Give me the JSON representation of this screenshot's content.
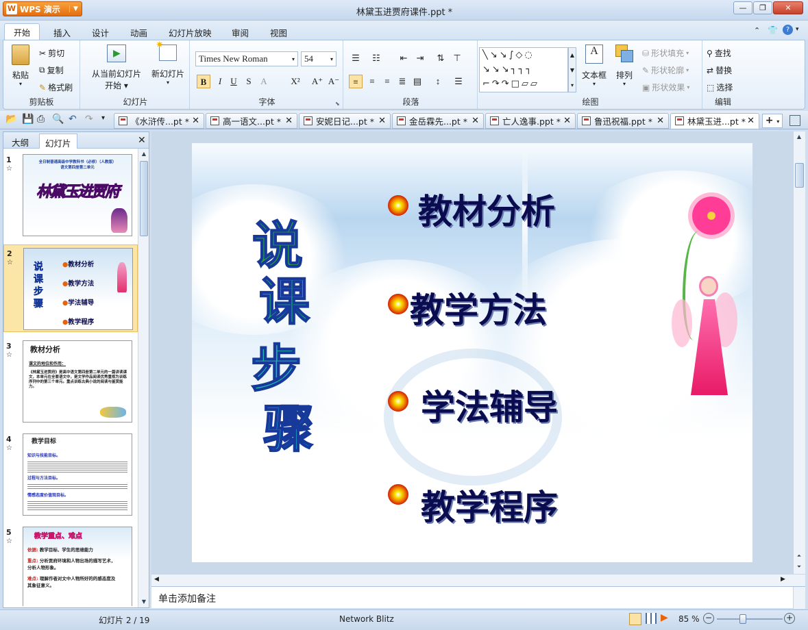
{
  "titlebar": {
    "app_button": "WPS 演示",
    "window_title": "林黛玉进贾府课件.ppt *"
  },
  "menu": [
    "开始",
    "插入",
    "设计",
    "动画",
    "幻灯片放映",
    "审阅",
    "视图"
  ],
  "ribbon": {
    "clipboard": {
      "paste": "粘贴",
      "cut": "剪切",
      "copy": "复制",
      "format_painter": "格式刷",
      "label": "剪贴板"
    },
    "slides": {
      "from_current": "从当前幻灯片",
      "start": "开始",
      "new_slide": "新幻灯片",
      "label": "幻灯片"
    },
    "font": {
      "font_name": "Times New Roman",
      "font_size": "54",
      "label": "字体"
    },
    "paragraph": {
      "label": "段落"
    },
    "drawing": {
      "textbox": "文本框",
      "arrange": "排列",
      "shape_fill": "形状填充",
      "shape_outline": "形状轮廓",
      "shape_effect": "形状效果",
      "label": "绘图"
    },
    "edit": {
      "find": "查找",
      "replace": "替换",
      "select": "选择",
      "label": "编辑"
    }
  },
  "doc_tabs": [
    "《水浒传...pt *",
    "高一语文...pt *",
    "安妮日记...pt *",
    "金岳霖先...pt *",
    "亡人逸事.ppt *",
    "鲁迅祝福.ppt *",
    "林黛玉进...pt *"
  ],
  "panel": {
    "tab_outline": "大纲",
    "tab_slides": "幻灯片"
  },
  "thumbs": [
    {
      "num": "1",
      "title": "林黛玉进贾府",
      "subtitle1": "全日制普通高级中学教科书（必修）（人教版）",
      "subtitle2": "语文第四册第二单元"
    },
    {
      "num": "2",
      "items": [
        "教材分析",
        "教学方法",
        "学法辅导",
        "教学程序"
      ],
      "vtext": [
        "说",
        "课",
        "步",
        "骤"
      ]
    },
    {
      "num": "3",
      "title": "教材分析",
      "line1": "课文的地位和作用：",
      "body": "《林黛玉进贾府》是高中语文第四册第二单元的一篇讲读课文，本单元在全套语文中，是文学作品阅读优秀重视为训练序列中的第三个单元。重点训练古典小说的阅读与鉴赏能力。"
    },
    {
      "num": "4",
      "title": "教学目标",
      "l1": "知识与技能目标。",
      "l2": "过程与方法目标。",
      "l3": "情感态度价值观目标。"
    },
    {
      "num": "5",
      "title": "教学重点、难点",
      "r1k": "依据:",
      "r1": "教学目标、学生的思维能力",
      "r2k": "重点:",
      "r2": "分析贾府环境和人物出场的描写艺术，分析人物形象。",
      "r3k": "难点:",
      "r3": "理解作者对文中人物所好的的感态度及其象征意义。"
    }
  ],
  "slide": {
    "vertical_title": [
      "说",
      "课",
      "步",
      "骤"
    ],
    "bullets": [
      "教材分析",
      "教学方法",
      "学法辅导",
      "教学程序"
    ]
  },
  "notes_placeholder": "单击添加备注",
  "status": {
    "slide_count": "幻灯片 2 / 19",
    "theme": "Network Blitz",
    "zoom": "85 %"
  },
  "colors": {
    "accent": "#e46d12",
    "title_text": "#0b0b4f",
    "selected_thumb": "#fbe6a8"
  }
}
